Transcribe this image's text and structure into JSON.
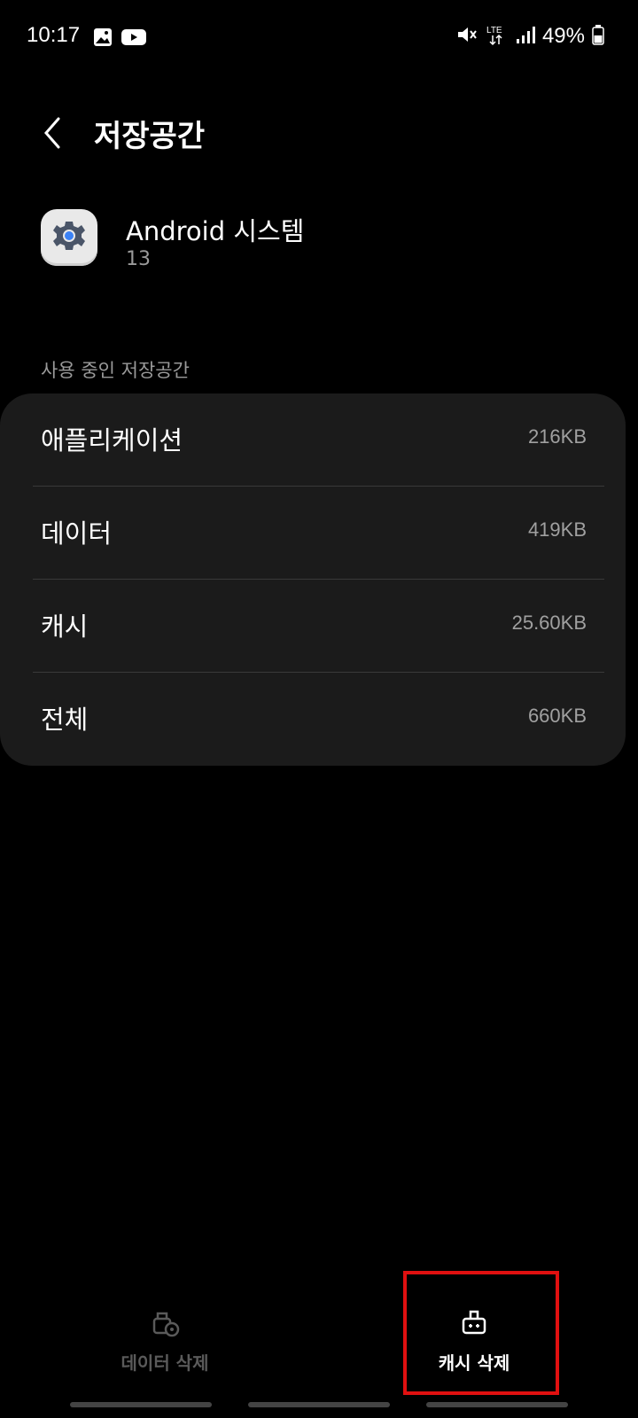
{
  "status_bar": {
    "time": "10:17",
    "battery": "49%",
    "network": "LTE"
  },
  "header": {
    "title": "저장공간"
  },
  "app": {
    "name": "Android 시스템",
    "version": "13"
  },
  "section": {
    "label": "사용 중인 저장공간"
  },
  "storage_rows": [
    {
      "label": "애플리케이션",
      "value": "216KB"
    },
    {
      "label": "데이터",
      "value": "419KB"
    },
    {
      "label": "캐시",
      "value": "25.60KB"
    },
    {
      "label": "전체",
      "value": "660KB"
    }
  ],
  "actions": {
    "clear_data": "데이터 삭제",
    "clear_cache": "캐시 삭제"
  },
  "colors": {
    "background": "#000000",
    "card": "#1b1b1b",
    "highlight": "#e01010",
    "secondary_text": "#9a9a9a"
  }
}
